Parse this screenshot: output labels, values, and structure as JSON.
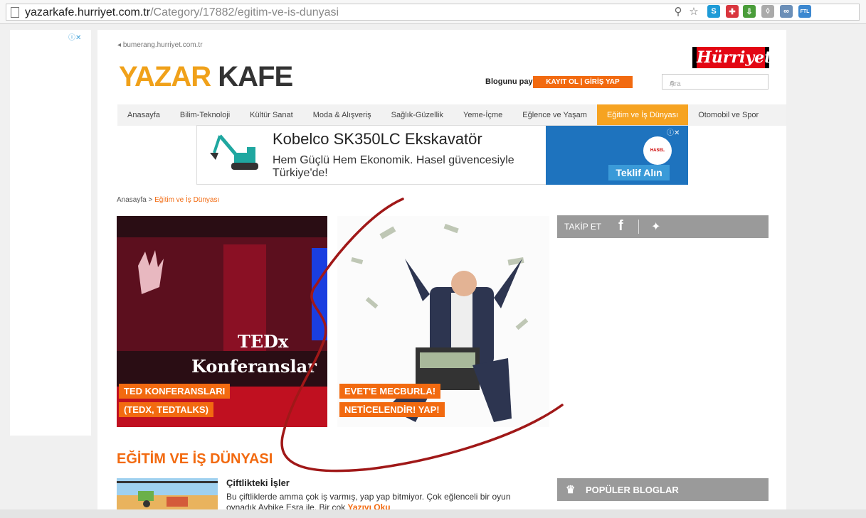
{
  "browser": {
    "url_host": "yazarkafe.hurriyet.com.tr",
    "url_path": "/Category/17882/egitim-ve-is-dunyasi",
    "extensions": [
      {
        "name": "zoom-icon",
        "glyph": "⚲",
        "color": "#666666"
      },
      {
        "name": "star-icon",
        "glyph": "☆",
        "color": "#666666"
      },
      {
        "name": "skype-icon",
        "glyph": "S",
        "color": "#1e9bd7"
      },
      {
        "name": "puzzle-icon",
        "glyph": "✚",
        "color": "#d9363e"
      },
      {
        "name": "download-icon",
        "glyph": "⇩",
        "color": "#4a9d3a"
      },
      {
        "name": "shield-icon",
        "glyph": "◊",
        "color": "#aaaaaa"
      },
      {
        "name": "link-icon",
        "glyph": "∞",
        "color": "#6b8fb8"
      },
      {
        "name": "ftl-icon",
        "glyph": "FTL",
        "color": "#3c88d0"
      }
    ]
  },
  "header": {
    "source_link": "bumerang.hurriyet.com.tr",
    "logo_part1": "YAZAR",
    "logo_part2": "KAFE",
    "brand": "Hürriyet",
    "share_label": "Blogunu paylaş",
    "register_label": "KAYIT OL",
    "login_label": "GİRİŞ YAP",
    "search_placeholder": "Ara"
  },
  "nav": {
    "items": [
      "Anasayfa",
      "Bilim-Teknoloji",
      "Kültür Sanat",
      "Moda & Alışveriş",
      "Sağlık-Güzellik",
      "Yeme-İçme",
      "Eğlence ve Yaşam",
      "Eğitim ve İş Dünyası",
      "Otomobil ve Spor"
    ],
    "active_index": 7
  },
  "ad": {
    "title": "Kobelco SK350LC Ekskavatör",
    "subtitle": "Hem Güçlü Hem Ekonomik. Hasel güvencesiyle Türkiye'de!",
    "cta": "Teklif Alın",
    "logo_text": "HASEL KOBELCO"
  },
  "breadcrumb": {
    "home": "Anasayfa",
    "separator": " > ",
    "current": "Eğitim ve İş Dünyası"
  },
  "features": [
    {
      "overlay_line1": "TEDx",
      "overlay_line2": "Konferanslar",
      "tag_line1": "TED KONFERANSLARI",
      "tag_line2": "(TEDX, TEDTALKS)"
    },
    {
      "tag_line1": "EVET'E MECBURLA!",
      "tag_line2": "NETİCELENDİR! YAP!"
    }
  ],
  "sidebar": {
    "follow_label": "TAKİP ET",
    "popular_label": "POPÜLER BLOGLAR"
  },
  "section": {
    "title": "EĞİTİM VE İŞ DÜNYASI",
    "article": {
      "title": "Çiftlikteki İşler",
      "description": "Bu çiftliklerde amma çok iş varmış, yap yap bitmiyor. Çok eğlenceli bir oyun oynadık Aybike Esra ile. Bir çok",
      "more": "Yazıyı Oku"
    }
  },
  "colors": {
    "accent": "#f26a10",
    "nav_active": "#f6a321",
    "logo_yellow": "#f0a11a",
    "ad_blue": "#1e73be"
  }
}
